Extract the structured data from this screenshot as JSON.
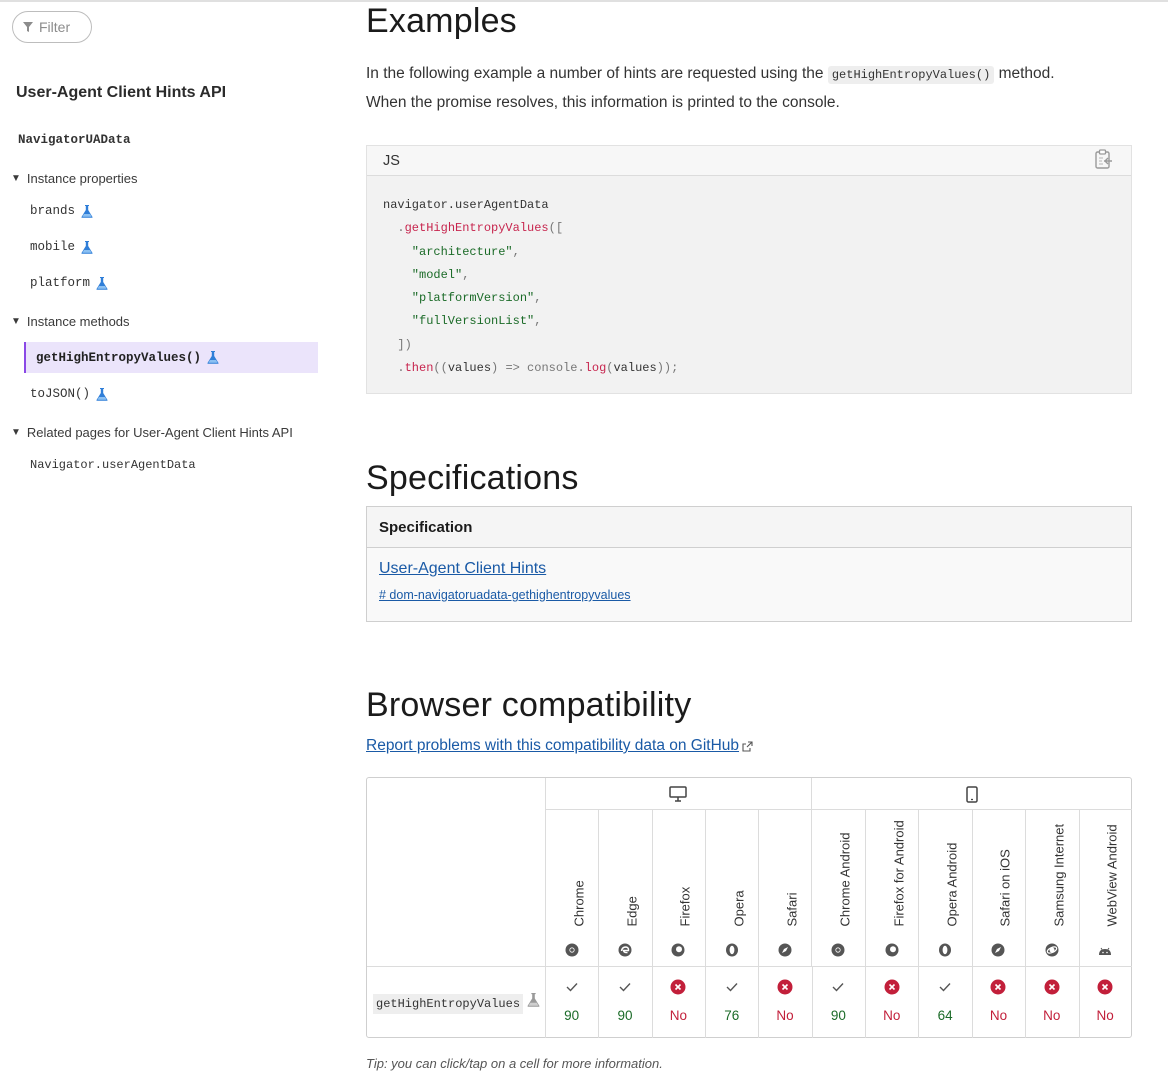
{
  "sidebar": {
    "filter_placeholder": "Filter",
    "title": "User-Agent Client Hints API",
    "interface": "NavigatorUAData",
    "instance_properties_heading": "Instance properties",
    "properties": [
      "brands",
      "mobile",
      "platform"
    ],
    "instance_methods_heading": "Instance methods",
    "methods": [
      "getHighEntropyValues()",
      "toJSON()"
    ],
    "related_heading": "Related pages for User-Agent Client Hints API",
    "related": [
      "Navigator.userAgentData"
    ]
  },
  "examples": {
    "heading": "Examples",
    "text_before": "In the following example a number of hints are requested using the",
    "inline_code": "getHighEntropyValues()",
    "text_after": "method.",
    "text_line2": "When the promise resolves, this information is printed to the console.",
    "code_lang": "JS",
    "code_lines": {
      "l1": "navigator.userAgentData",
      "l2_dot": "  .",
      "l2_fn": "getHighEntropyValues",
      "l2_rest": "([",
      "l3": "    \"architecture\"",
      "l4": "    \"model\"",
      "l5": "    \"platformVersion\"",
      "l6": "    \"fullVersionList\"",
      "l7": "  ])",
      "l8_dot": "  .",
      "l8_fn": "then",
      "l8_a": "((",
      "l8_b": "values",
      "l8_c": ") => console.",
      "l8_fn2": "log",
      "l8_d": "(",
      "l8_e": "values",
      "l8_f": "));",
      "comma": ","
    }
  },
  "specifications": {
    "heading": "Specifications",
    "column": "Specification",
    "spec_name": "User-Agent Client Hints",
    "spec_anchor": "# dom-navigatoruadata-gethighentropyvalues"
  },
  "compat": {
    "heading": "Browser compatibility",
    "report_link": "Report problems with this compatibility data on GitHub",
    "feature": "getHighEntropyValues",
    "browsers": [
      {
        "name": "Chrome",
        "icon": "chrome-icon",
        "supported": true,
        "version": "90"
      },
      {
        "name": "Edge",
        "icon": "edge-icon",
        "supported": true,
        "version": "90"
      },
      {
        "name": "Firefox",
        "icon": "firefox-icon",
        "supported": false,
        "version": "No"
      },
      {
        "name": "Opera",
        "icon": "opera-icon",
        "supported": true,
        "version": "76"
      },
      {
        "name": "Safari",
        "icon": "safari-icon",
        "supported": false,
        "version": "No"
      },
      {
        "name": "Chrome Android",
        "icon": "chrome-icon",
        "supported": true,
        "version": "90"
      },
      {
        "name": "Firefox for Android",
        "icon": "firefox-icon",
        "supported": false,
        "version": "No"
      },
      {
        "name": "Opera Android",
        "icon": "opera-icon",
        "supported": true,
        "version": "64"
      },
      {
        "name": "Safari on iOS",
        "icon": "safari-icon",
        "supported": false,
        "version": "No"
      },
      {
        "name": "Samsung Internet",
        "icon": "samsung-internet-icon",
        "supported": false,
        "version": "No"
      },
      {
        "name": "WebView Android",
        "icon": "android-icon",
        "supported": false,
        "version": "No"
      }
    ],
    "tip": "Tip: you can click/tap on a cell for more information.",
    "colors": {
      "yes": "#1b6b28",
      "no": "#c21f3a"
    }
  }
}
